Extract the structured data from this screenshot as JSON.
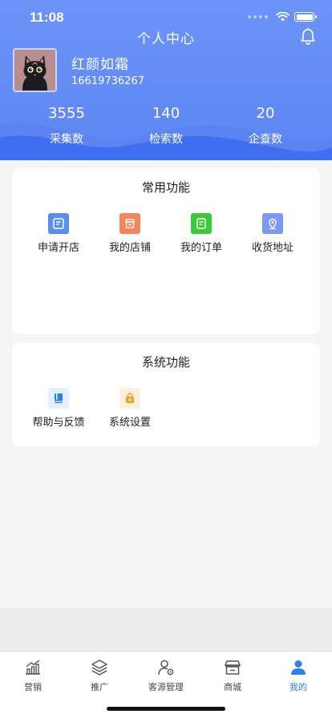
{
  "status_bar": {
    "time": "11:08"
  },
  "header": {
    "title": "个人中心",
    "username": "红颜如霜",
    "phone": "16619736267",
    "stats": [
      {
        "value": "3555",
        "label": "采集数"
      },
      {
        "value": "140",
        "label": "检索数"
      },
      {
        "value": "20",
        "label": "企查数"
      }
    ]
  },
  "common_functions": {
    "title": "常用功能",
    "items": [
      {
        "label": "申请开店",
        "icon": "apply-store-icon",
        "color": "#5b8cf0"
      },
      {
        "label": "我的店铺",
        "icon": "store-icon",
        "color": "#f3865a"
      },
      {
        "label": "我的订单",
        "icon": "order-icon",
        "color": "#3ec93c"
      },
      {
        "label": "收货地址",
        "icon": "location-icon",
        "color": "#7d97f5"
      }
    ]
  },
  "system_functions": {
    "title": "系统功能",
    "items": [
      {
        "label": "帮助与反馈",
        "icon": "help-book-icon",
        "color": "#2f80ed"
      },
      {
        "label": "系统设置",
        "icon": "settings-icon",
        "color": "#f1a12e"
      }
    ]
  },
  "tabbar": {
    "items": [
      {
        "label": "营销",
        "icon": "chart-icon",
        "active": false
      },
      {
        "label": "推广",
        "icon": "layers-icon",
        "active": false
      },
      {
        "label": "客源管理",
        "icon": "user-gear-icon",
        "active": false
      },
      {
        "label": "商城",
        "icon": "shop-icon",
        "active": false
      },
      {
        "label": "我的",
        "icon": "profile-icon",
        "active": true
      }
    ]
  },
  "colors": {
    "header": "#6b93f7",
    "wave": "#3f6ef0",
    "accent": "#2f80ed"
  }
}
